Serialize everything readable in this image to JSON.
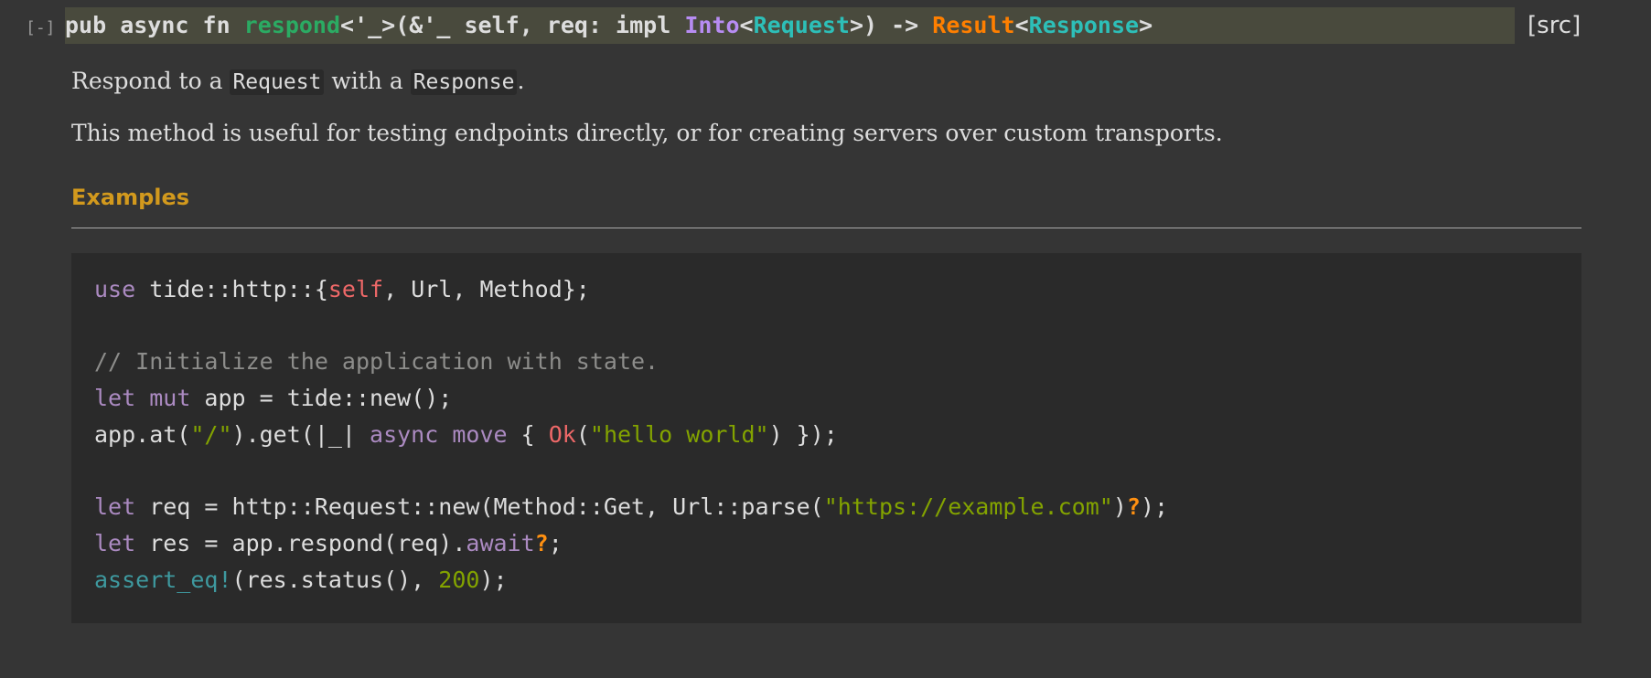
{
  "toggle": {
    "label": "[-]"
  },
  "signature": {
    "prefix": "pub async fn ",
    "fn_name": "respond",
    "lifetime_part": "<'_>(&'_ self, req: impl ",
    "trait_name": "Into",
    "lt": "<",
    "request_type": "Request",
    "after_request": ">) -> ",
    "result_type": "Result",
    "lt2": "<",
    "response_type": "Response",
    "end": ">"
  },
  "src_link": {
    "label": "[src]"
  },
  "docs": {
    "p1_a": "Respond to a ",
    "p1_code1": "Request",
    "p1_b": " with a ",
    "p1_code2": "Response",
    "p1_c": ".",
    "p2": "This method is useful for testing endpoints directly, or for creating servers over custom transports."
  },
  "examples": {
    "heading": "Examples"
  },
  "code": {
    "l1_use": "use",
    "l1_a": " tide::http::{",
    "l1_self": "self",
    "l1_b": ", Url, Method};",
    "l3_comment": "// Initialize the application with state.",
    "l4_let": "let",
    "l4_mut": "mut",
    "l4_rest": " app = tide::new();",
    "l5_a": "app.at(",
    "l5_str": "\"/\"",
    "l5_b": ").get(|_| ",
    "l5_async": "async",
    "l5_move": "move",
    "l5_c": " { ",
    "l5_ok": "Ok",
    "l5_d": "(",
    "l5_str2": "\"hello world\"",
    "l5_e": ") });",
    "l7_let": "let",
    "l7_a": " req = http::Request::new(Method::Get, Url::parse(",
    "l7_str": "\"https://example.com\"",
    "l7_b": ")",
    "l7_q": "?",
    "l7_c": ");",
    "l8_let": "let",
    "l8_a": " res = app.respond(req).",
    "l8_await": "await",
    "l8_q": "?",
    "l8_b": ";",
    "l9_mac": "assert_eq!",
    "l9_a": "(res.status(), ",
    "l9_num": "200",
    "l9_b": ");"
  }
}
